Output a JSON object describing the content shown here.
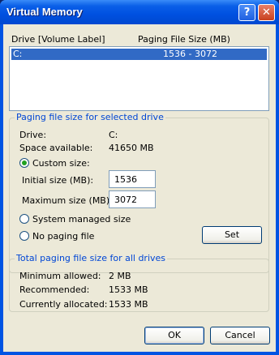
{
  "window": {
    "title": "Virtual Memory"
  },
  "list": {
    "col_drive": "Drive  [Volume Label]",
    "col_size": "Paging File Size (MB)",
    "rows": [
      {
        "drive": "C:",
        "size": "1536 - 3072",
        "selected": true
      }
    ]
  },
  "selected_drive": {
    "group_title": "Paging file size for selected drive",
    "drive_label": "Drive:",
    "drive_value": "C:",
    "space_label": "Space available:",
    "space_value": "41650 MB",
    "custom_label": "Custom size:",
    "initial_label": "Initial size (MB):",
    "initial_value": "1536",
    "maximum_label": "Maximum size (MB):",
    "maximum_value": "3072",
    "system_label": "System managed size",
    "nopaging_label": "No paging file",
    "set_label": "Set",
    "selected_option": "custom"
  },
  "totals": {
    "group_title": "Total paging file size for all drives",
    "min_label": "Minimum allowed:",
    "min_value": "2 MB",
    "rec_label": "Recommended:",
    "rec_value": "1533 MB",
    "cur_label": "Currently allocated:",
    "cur_value": "1533 MB"
  },
  "buttons": {
    "ok": "OK",
    "cancel": "Cancel"
  },
  "colors": {
    "titlebar": "#0054e3",
    "dialog_bg": "#ece9d8",
    "selection": "#316ac5",
    "group_title": "#0046d5"
  }
}
